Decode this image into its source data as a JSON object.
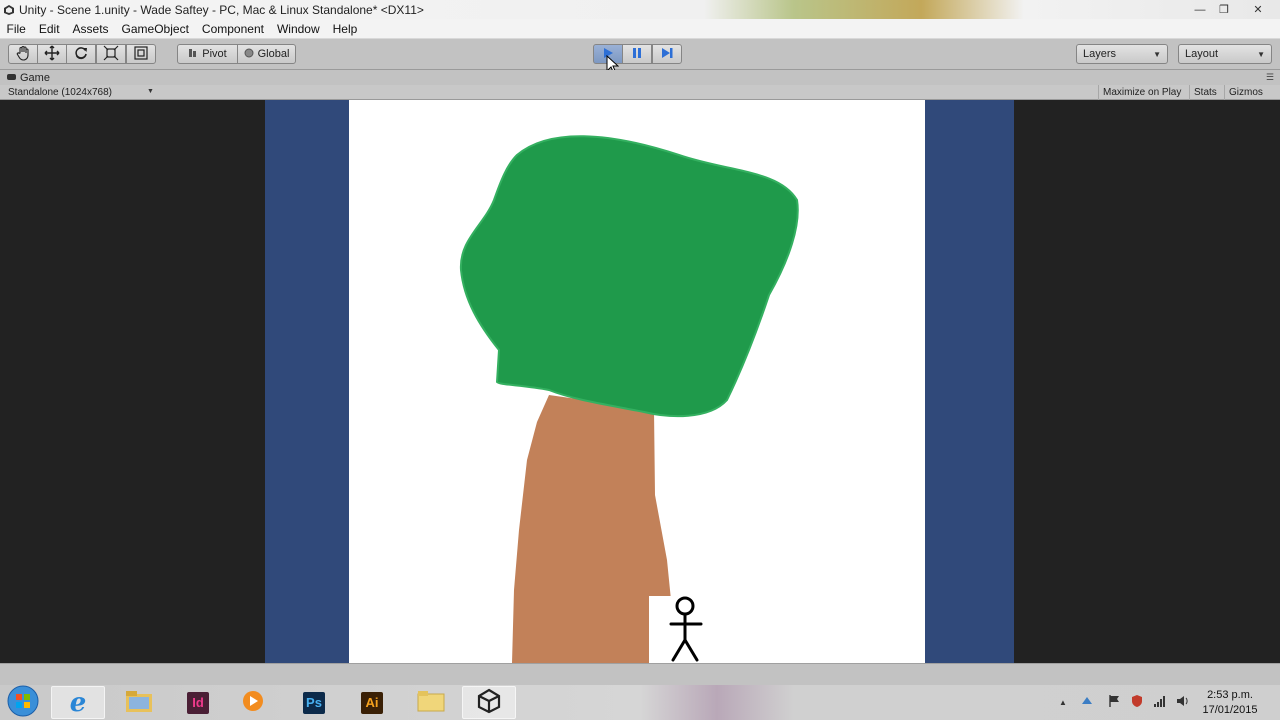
{
  "window": {
    "title": "Unity - Scene 1.unity - Wade Saftey - PC, Mac & Linux Standalone* <DX11>",
    "controls": {
      "minimize": "—",
      "maximize": "❐",
      "close": "✕"
    }
  },
  "menu": [
    "File",
    "Edit",
    "Assets",
    "GameObject",
    "Component",
    "Window",
    "Help"
  ],
  "toolbar": {
    "tools": [
      "hand-icon",
      "move-icon",
      "rotate-icon",
      "scale-icon",
      "rect-icon"
    ],
    "pivot_label": "Pivot",
    "global_label": "Global",
    "layers_label": "Layers",
    "layout_label": "Layout",
    "play_state": "playing"
  },
  "game_panel": {
    "tab_label": "Game",
    "resolution": "Standalone (1024x768)",
    "maximize_label": "Maximize on Play",
    "stats_label": "Stats",
    "gizmos_label": "Gizmos"
  },
  "scene": {
    "letterbox_color": "#30497a",
    "canvas_color": "#ffffff",
    "foliage_color": "#1f9a4b",
    "trunk_color": "#c28159",
    "figure_color": "#000000"
  },
  "taskbar": {
    "apps": [
      "internet-explorer-icon",
      "file-explorer-icon",
      "indesign-icon",
      "media-player-icon",
      "photoshop-icon",
      "illustrator-icon",
      "folder-icon",
      "unity-icon"
    ],
    "indesign_label": "Id",
    "photoshop_label": "Ps",
    "illustrator_label": "Ai",
    "time": "2:53 p.m.",
    "date": "17/01/2015"
  }
}
